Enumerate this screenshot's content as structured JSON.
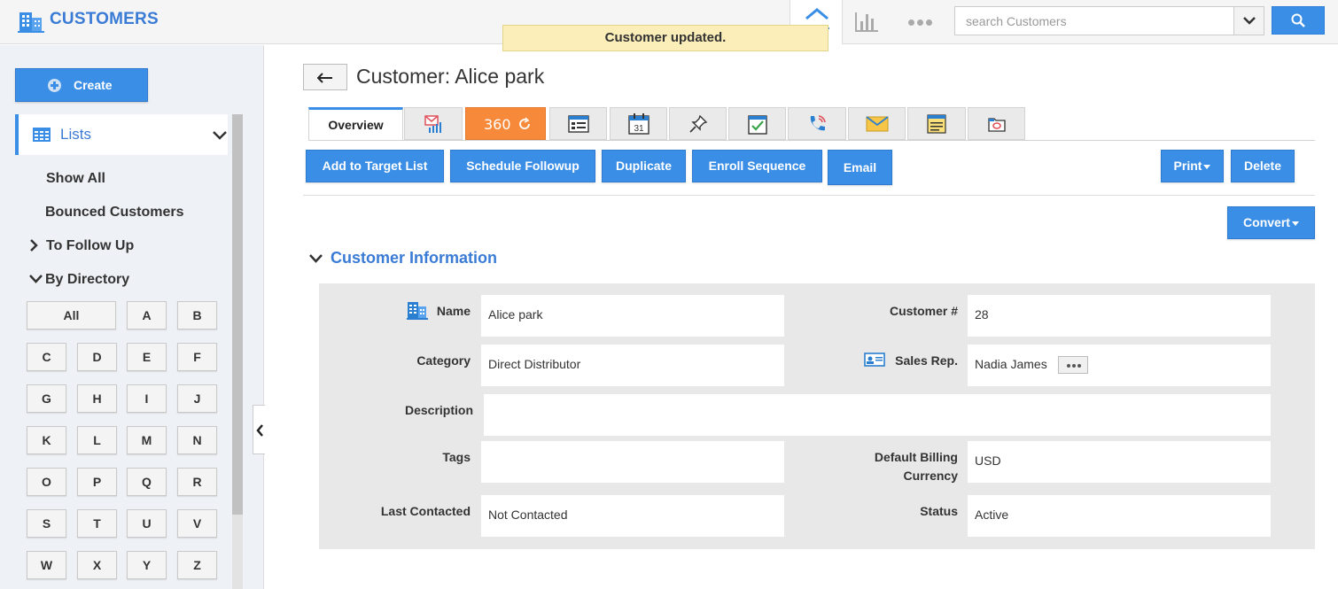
{
  "app": {
    "title": "CUSTOMERS",
    "logo_icon": "building-icon"
  },
  "search": {
    "placeholder": "search Customers"
  },
  "top_nav": [
    "home-icon",
    "chart-icon",
    "more-icon"
  ],
  "toast": {
    "message": "Customer updated."
  },
  "sidebar": {
    "create_label": "Create",
    "lists_label": "Lists",
    "show_all": "Show All",
    "bounced": "Bounced Customers",
    "follow_up": "To Follow Up",
    "by_directory": "By Directory",
    "letters": [
      "All",
      "A",
      "B",
      "C",
      "D",
      "E",
      "F",
      "G",
      "H",
      "I",
      "J",
      "K",
      "L",
      "M",
      "N",
      "O",
      "P",
      "Q",
      "R",
      "S",
      "T",
      "U",
      "V",
      "W",
      "X",
      "Y",
      "Z"
    ]
  },
  "page": {
    "title": "Customer: Alice park"
  },
  "tabs": {
    "overview": "Overview",
    "three_sixty": "360",
    "icons": [
      "email-stats-icon",
      "360-icon",
      "details-icon",
      "calendar-icon",
      "pin-icon",
      "task-icon",
      "call-icon",
      "mail-icon",
      "notes-icon",
      "attachment-icon"
    ],
    "calendar_day": "31"
  },
  "actions": {
    "add_to_target": "Add to Target List",
    "schedule": "Schedule Followup",
    "duplicate": "Duplicate",
    "enroll": "Enroll Sequence",
    "email": "Email",
    "print": "Print",
    "delete": "Delete",
    "convert": "Convert"
  },
  "section": {
    "title": "Customer Information"
  },
  "fields": {
    "name": {
      "label": "Name",
      "value": "Alice park"
    },
    "customer_num": {
      "label": "Customer #",
      "value": "28"
    },
    "category": {
      "label": "Category",
      "value": "Direct Distributor"
    },
    "sales_rep": {
      "label": "Sales Rep.",
      "value": "Nadia James"
    },
    "description": {
      "label": "Description",
      "value": ""
    },
    "tags": {
      "label": "Tags",
      "value": ""
    },
    "billing_currency": {
      "label_line1": "Default Billing",
      "label_line2": "Currency",
      "value": "USD"
    },
    "last_contacted": {
      "label": "Last Contacted",
      "value": "Not Contacted"
    },
    "status": {
      "label": "Status",
      "value": "Active"
    }
  },
  "colors": {
    "accent": "#3a8ee6",
    "title_blue": "#3a7bd5",
    "toast_bg": "#fbeeb8",
    "tab_360": "#f6893a"
  }
}
